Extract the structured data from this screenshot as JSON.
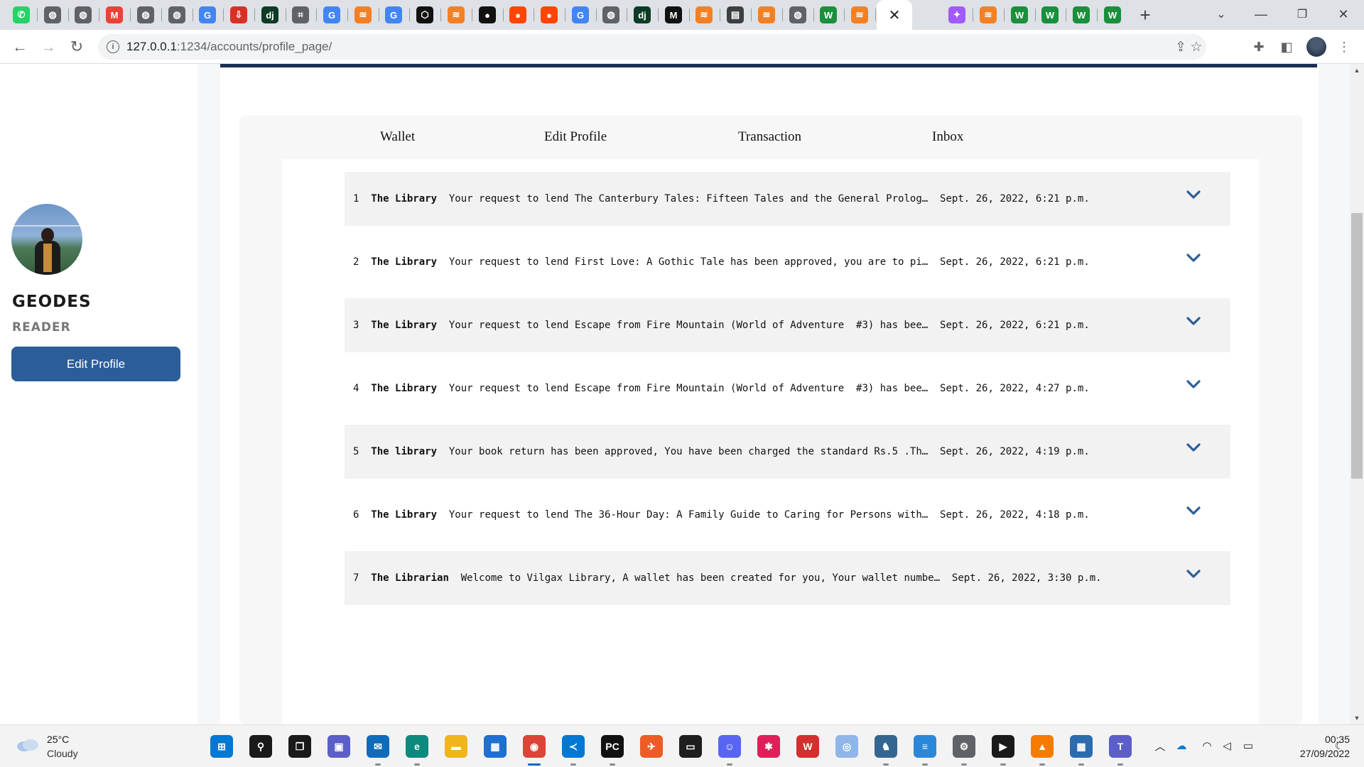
{
  "browser": {
    "tabs": [
      {
        "icon": "whatsapp-icon",
        "color": "#25d366",
        "glyph": "✆"
      },
      {
        "icon": "globe-icon",
        "color": "#5f6368",
        "glyph": "◍"
      },
      {
        "icon": "globe-icon",
        "color": "#5f6368",
        "glyph": "◍"
      },
      {
        "icon": "gmail-icon",
        "color": "#ea4335",
        "glyph": "M"
      },
      {
        "icon": "globe-icon",
        "color": "#5f6368",
        "glyph": "◍"
      },
      {
        "icon": "globe-icon",
        "color": "#5f6368",
        "glyph": "◍"
      },
      {
        "icon": "google-icon",
        "color": "#4285f4",
        "glyph": "G"
      },
      {
        "icon": "download-icon",
        "color": "#d93025",
        "glyph": "⇩"
      },
      {
        "icon": "django-icon",
        "color": "#0c3c26",
        "glyph": "dj"
      },
      {
        "icon": "puzzle-icon",
        "color": "#5f6368",
        "glyph": "⌗"
      },
      {
        "icon": "google-icon",
        "color": "#4285f4",
        "glyph": "G"
      },
      {
        "icon": "stackoverflow-icon",
        "color": "#f48024",
        "glyph": "≋"
      },
      {
        "icon": "google-icon",
        "color": "#4285f4",
        "glyph": "G"
      },
      {
        "icon": "codepen-icon",
        "color": "#111111",
        "glyph": "⬡"
      },
      {
        "icon": "stackoverflow-icon",
        "color": "#f48024",
        "glyph": "≋"
      },
      {
        "icon": "github-icon",
        "color": "#111111",
        "glyph": "●"
      },
      {
        "icon": "reddit-icon",
        "color": "#ff4500",
        "glyph": "●"
      },
      {
        "icon": "reddit-icon",
        "color": "#ff4500",
        "glyph": "●"
      },
      {
        "icon": "google-icon",
        "color": "#4285f4",
        "glyph": "G"
      },
      {
        "icon": "globe-icon",
        "color": "#5f6368",
        "glyph": "◍"
      },
      {
        "icon": "django-icon",
        "color": "#0c3c26",
        "glyph": "dj"
      },
      {
        "icon": "medium-icon",
        "color": "#111111",
        "glyph": "M"
      },
      {
        "icon": "stackoverflow-icon",
        "color": "#f48024",
        "glyph": "≋"
      },
      {
        "icon": "reader-icon",
        "color": "#3c4043",
        "glyph": "▤"
      },
      {
        "icon": "stackoverflow-icon",
        "color": "#f48024",
        "glyph": "≋"
      },
      {
        "icon": "globe-icon",
        "color": "#5f6368",
        "glyph": "◍"
      },
      {
        "icon": "webflow-icon",
        "color": "#1a8f3c",
        "glyph": "W"
      },
      {
        "icon": "stackoverflow-icon",
        "color": "#f48024",
        "glyph": "≋"
      },
      {
        "icon": "evernote-icon",
        "color": "#00a82d",
        "glyph": "✎"
      },
      {
        "icon": "figma-icon",
        "color": "#a259ff",
        "glyph": "✦"
      },
      {
        "icon": "stackoverflow-icon",
        "color": "#f48024",
        "glyph": "≋"
      },
      {
        "icon": "webflow-icon",
        "color": "#1a8f3c",
        "glyph": "W"
      },
      {
        "icon": "webflow-icon",
        "color": "#1a8f3c",
        "glyph": "W"
      },
      {
        "icon": "webflow-icon",
        "color": "#1a8f3c",
        "glyph": "W"
      },
      {
        "icon": "webflow-icon",
        "color": "#1a8f3c",
        "glyph": "W"
      }
    ],
    "url_host": "127.0.0.1",
    "url_rest": ":1234/accounts/profile_page/"
  },
  "profile": {
    "username": "GEODES",
    "role": "READER",
    "edit_button": "Edit Profile"
  },
  "nav_tabs": [
    "Wallet",
    "Edit Profile",
    "Transaction",
    "Inbox"
  ],
  "messages": [
    {
      "num": "1",
      "sender": "The Library",
      "text": "Your request to lend The Canterbury Tales: Fifteen Tales and the General Prolog…",
      "date": "Sept. 26, 2022, 6:21 p.m."
    },
    {
      "num": "2",
      "sender": "The Library",
      "text": "Your request to lend First Love: A Gothic Tale has been approved, you are to pi…",
      "date": "Sept. 26, 2022, 6:21 p.m."
    },
    {
      "num": "3",
      "sender": "The Library",
      "text": "Your request to lend Escape from Fire Mountain (World of Adventure  #3) has bee…",
      "date": "Sept. 26, 2022, 6:21 p.m."
    },
    {
      "num": "4",
      "sender": "The Library",
      "text": "Your request to lend Escape from Fire Mountain (World of Adventure  #3) has bee…",
      "date": "Sept. 26, 2022, 4:27 p.m."
    },
    {
      "num": "5",
      "sender": "The library",
      "text": "Your book return has been approved, You have been charged the standard Rs.5 .Th…",
      "date": "Sept. 26, 2022, 4:19 p.m."
    },
    {
      "num": "6",
      "sender": "The Library",
      "text": "Your request to lend The 36-Hour Day: A Family Guide to Caring for Persons with…",
      "date": "Sept. 26, 2022, 4:18 p.m."
    },
    {
      "num": "7",
      "sender": "The Librarian",
      "text": "Welcome to Vilgax Library, A wallet has been created for you, Your wallet numbe…",
      "date": "Sept. 26, 2022, 3:30 p.m."
    }
  ],
  "taskbar": {
    "weather_temp": "25°C",
    "weather_desc": "Cloudy",
    "apps": [
      {
        "icon": "windows-start-icon",
        "color": "#0078d4",
        "glyph": "⊞",
        "indicator": "none"
      },
      {
        "icon": "search-icon",
        "color": "#1a1a1a",
        "glyph": "⚲",
        "indicator": "none"
      },
      {
        "icon": "task-view-icon",
        "color": "#1a1a1a",
        "glyph": "❐",
        "indicator": "none"
      },
      {
        "icon": "teams-chat-icon",
        "color": "#5b5fc7",
        "glyph": "▣",
        "indicator": "none"
      },
      {
        "icon": "mail-icon",
        "color": "#0f6cbd",
        "glyph": "✉",
        "indicator": "running"
      },
      {
        "icon": "edge-icon",
        "color": "#0c8a7e",
        "glyph": "e",
        "indicator": "running"
      },
      {
        "icon": "file-explorer-icon",
        "color": "#f0b51d",
        "glyph": "▬",
        "indicator": "none"
      },
      {
        "icon": "store-icon",
        "color": "#1f6fd1",
        "glyph": "▦",
        "indicator": "none"
      },
      {
        "icon": "chrome-icon",
        "color": "#db4437",
        "glyph": "◉",
        "indicator": "active"
      },
      {
        "icon": "vscode-icon",
        "color": "#0078d4",
        "glyph": "≺",
        "indicator": "running"
      },
      {
        "icon": "pycharm-icon",
        "color": "#111111",
        "glyph": "PC",
        "indicator": "running"
      },
      {
        "icon": "postman-icon",
        "color": "#ef5b25",
        "glyph": "✈",
        "indicator": "none"
      },
      {
        "icon": "terminal-icon",
        "color": "#1e1e1e",
        "glyph": "▭",
        "indicator": "none"
      },
      {
        "icon": "discord-icon",
        "color": "#5865f2",
        "glyph": "☺",
        "indicator": "running"
      },
      {
        "icon": "slack-icon",
        "color": "#e01e5a",
        "glyph": "✱",
        "indicator": "none"
      },
      {
        "icon": "wps-office-icon",
        "color": "#d32f2f",
        "glyph": "W",
        "indicator": "none"
      },
      {
        "icon": "cortana-icon",
        "color": "#8fb6e8",
        "glyph": "◎",
        "indicator": "none"
      },
      {
        "icon": "postgres-icon",
        "color": "#336791",
        "glyph": "♞",
        "indicator": "running"
      },
      {
        "icon": "notepad-icon",
        "color": "#2b88d8",
        "glyph": "≡",
        "indicator": "running"
      },
      {
        "icon": "settings-icon",
        "color": "#5f6368",
        "glyph": "⚙",
        "indicator": "running"
      },
      {
        "icon": "media-player-icon",
        "color": "#1a1a1a",
        "glyph": "▶",
        "indicator": "running"
      },
      {
        "icon": "vlc-icon",
        "color": "#f57c00",
        "glyph": "▲",
        "indicator": "running"
      },
      {
        "icon": "remote-desktop-icon",
        "color": "#2b6cb0",
        "glyph": "▦",
        "indicator": "running"
      },
      {
        "icon": "teams-icon",
        "color": "#5b5fc7",
        "glyph": "T",
        "indicator": "running"
      }
    ],
    "time": "00:35",
    "date": "27/09/2022"
  }
}
